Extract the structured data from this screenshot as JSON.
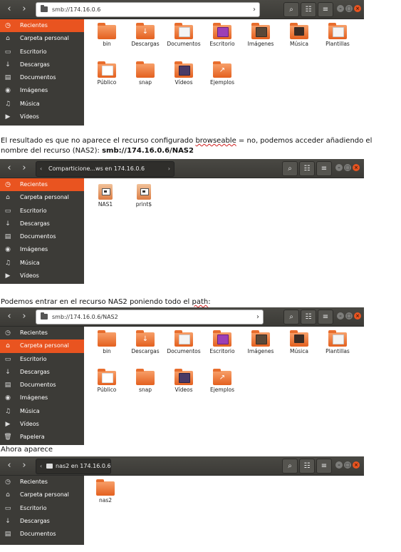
{
  "captions": {
    "c1_before": "El resultado es que no aparece el recurso configurado ",
    "c1_browse": "browseable",
    "c1_after": " = no, podemos acceder añadiendo el",
    "c1_line2": "nombre del recurso (NAS2): ",
    "c1_bold": "smb://174.16.0.6/NAS2",
    "c2_before": "Podemos entrar en el recurso NAS2 poniendo todo el ",
    "c2_path": "path",
    "c2_after": ":",
    "c3": "Ahora aparece"
  },
  "window_controls": {
    "minimize": "–",
    "maximize": "□",
    "close": "×"
  },
  "toolbar": {
    "search": "⌕",
    "view": "☷",
    "menu": "≡"
  },
  "nav": {
    "back": "‹",
    "forward": "›"
  },
  "s1": {
    "location": "smb://174.16.0.6",
    "sidebar": [
      {
        "label": "Recientes",
        "icon": "◷",
        "sel": true
      },
      {
        "label": "Carpeta personal",
        "icon": "⌂"
      },
      {
        "label": "Escritorio",
        "icon": "▭"
      },
      {
        "label": "Descargas",
        "icon": "↓"
      },
      {
        "label": "Documentos",
        "icon": "▤"
      },
      {
        "label": "Imágenes",
        "icon": "◉"
      },
      {
        "label": "Música",
        "icon": "♫"
      },
      {
        "label": "Vídeos",
        "icon": "▶"
      }
    ],
    "files": [
      "bin",
      "Descargas",
      "Documentos",
      "Escritorio",
      "Imágenes",
      "Música",
      "Plantillas",
      "Público",
      "snap",
      "Vídeos",
      "Ejemplos"
    ]
  },
  "s2": {
    "location": "Comparticione...ws en 174.16.0.6",
    "sidebar": [
      {
        "label": "Recientes",
        "icon": "◷",
        "sel": true
      },
      {
        "label": "Carpeta personal",
        "icon": "⌂"
      },
      {
        "label": "Escritorio",
        "icon": "▭"
      },
      {
        "label": "Descargas",
        "icon": "↓"
      },
      {
        "label": "Documentos",
        "icon": "▤"
      },
      {
        "label": "Imágenes",
        "icon": "◉"
      },
      {
        "label": "Música",
        "icon": "♫"
      },
      {
        "label": "Vídeos",
        "icon": "▶"
      }
    ],
    "files": [
      "NAS1",
      "print$"
    ]
  },
  "s3": {
    "location": "smb://174.16.0.6/NAS2",
    "sidebar": [
      {
        "label": "Recientes",
        "icon": "◷"
      },
      {
        "label": "Carpeta personal",
        "icon": "⌂",
        "sel": true
      },
      {
        "label": "Escritorio",
        "icon": "▭"
      },
      {
        "label": "Descargas",
        "icon": "↓"
      },
      {
        "label": "Documentos",
        "icon": "▤"
      },
      {
        "label": "Imágenes",
        "icon": "◉"
      },
      {
        "label": "Música",
        "icon": "♫"
      },
      {
        "label": "Vídeos",
        "icon": "▶"
      },
      {
        "label": "Papelera",
        "icon": "🗑"
      }
    ],
    "files": [
      "bin",
      "Descargas",
      "Documentos",
      "Escritorio",
      "Imágenes",
      "Música",
      "Plantillas",
      "Público",
      "snap",
      "Vídeos",
      "Ejemplos"
    ]
  },
  "s4": {
    "location": "nas2 en 174.16.0.6",
    "sidebar": [
      {
        "label": "Recientes",
        "icon": "◷"
      },
      {
        "label": "Carpeta personal",
        "icon": "⌂"
      },
      {
        "label": "Escritorio",
        "icon": "▭"
      },
      {
        "label": "Descargas",
        "icon": "↓"
      },
      {
        "label": "Documentos",
        "icon": "▤"
      }
    ],
    "files": [
      "nas2"
    ]
  }
}
